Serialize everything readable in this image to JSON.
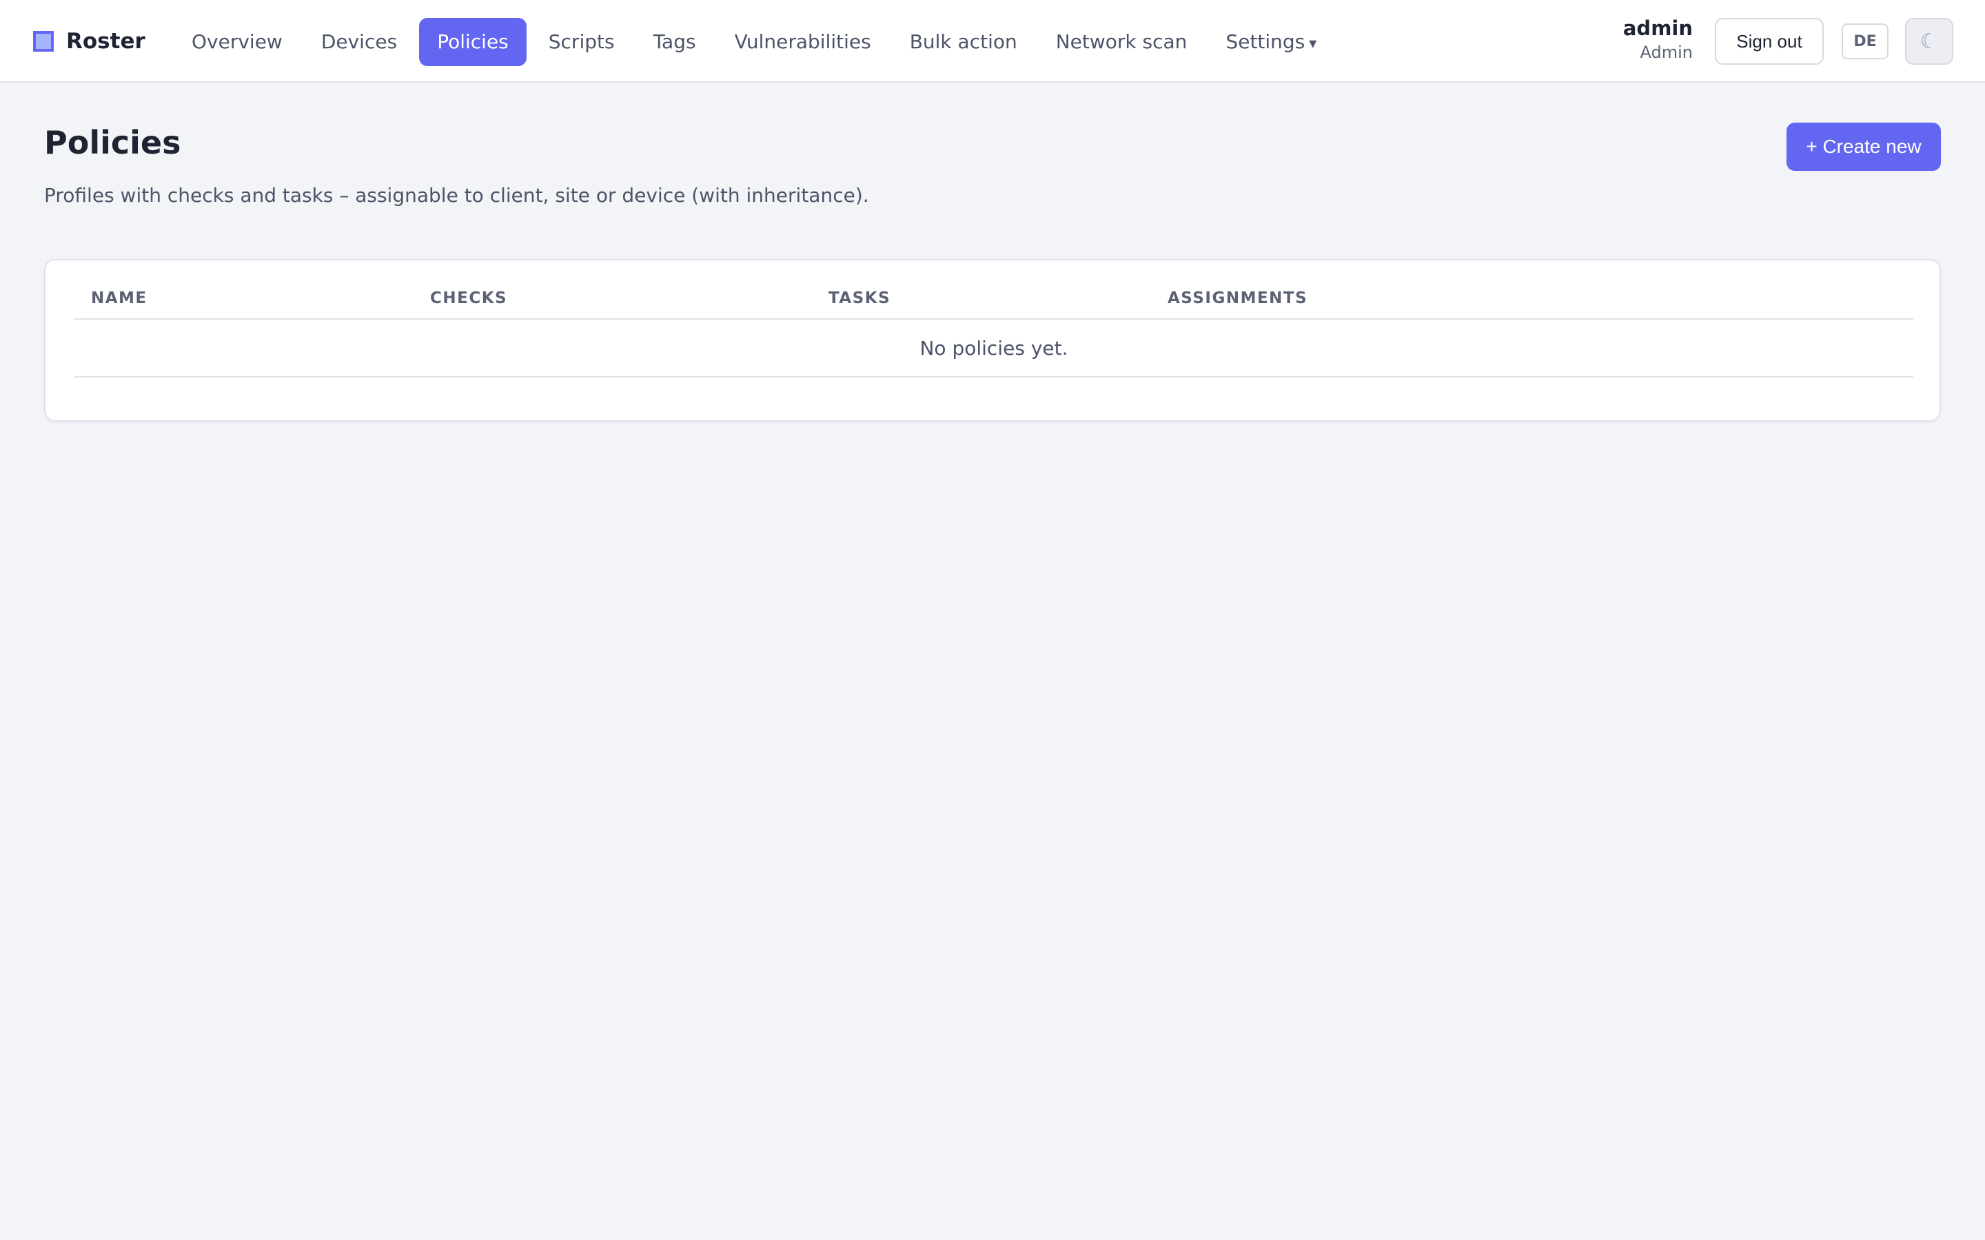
{
  "brand": {
    "name": "Roster"
  },
  "nav": {
    "items": [
      {
        "label": "Overview"
      },
      {
        "label": "Devices"
      },
      {
        "label": "Policies"
      },
      {
        "label": "Scripts"
      },
      {
        "label": "Tags"
      },
      {
        "label": "Vulnerabilities"
      },
      {
        "label": "Bulk action"
      },
      {
        "label": "Network scan"
      },
      {
        "label": "Settings",
        "caret": "▾"
      }
    ],
    "active_index": 2
  },
  "user": {
    "name": "admin",
    "role": "Admin"
  },
  "header_actions": {
    "sign_out_label": "Sign out",
    "language_label": "DE",
    "theme_icon": "moon-icon",
    "theme_glyph": "☾"
  },
  "page": {
    "title": "Policies",
    "subtitle": "Profiles with checks and tasks – assignable to client, site or device (with inheritance).",
    "create_label": "+ Create new"
  },
  "table": {
    "columns": [
      "NAME",
      "CHECKS",
      "TASKS",
      "ASSIGNMENTS"
    ],
    "rows": [],
    "empty_message": "No policies yet."
  },
  "colors": {
    "accent": "#6366f1",
    "background": "#f3f4f8",
    "text": "#1f2433",
    "muted_text": "#4d5468"
  }
}
